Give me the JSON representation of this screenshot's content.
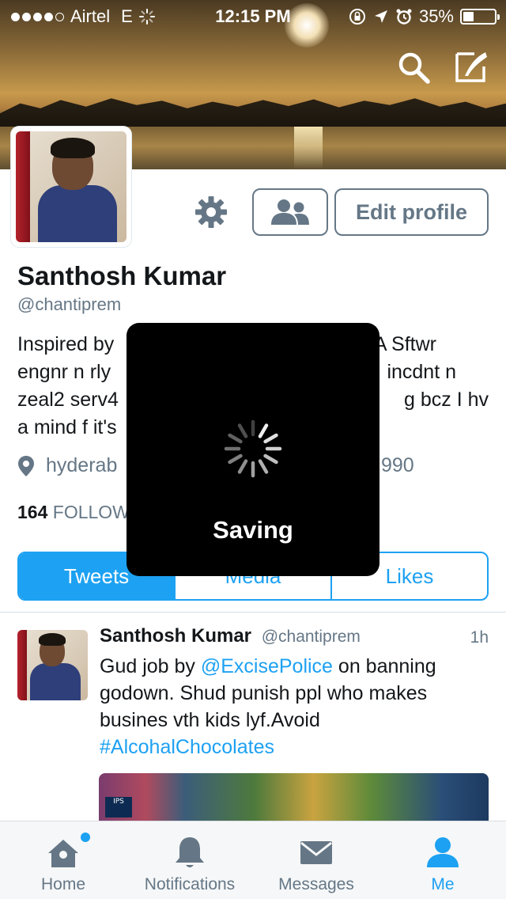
{
  "status_bar": {
    "carrier": "Airtel",
    "network": "E",
    "time": "12:15 PM",
    "battery": "35%",
    "battery_level": 0.35
  },
  "header": {
    "search_icon": "search-icon",
    "compose_icon": "compose-icon"
  },
  "profile": {
    "name": "Santhosh Kumar",
    "handle": "@chantiprem",
    "bio_lines": [
      "Inspired by",
      "A Sftwr",
      "engnr n rly",
      "incdnt n",
      "zeal2 serv4",
      "g bcz I hv",
      "a mind f it's"
    ],
    "location": "hyderab",
    "birth_fragment": "990",
    "following_count": "164",
    "following_label": "FOLLOW",
    "edit_profile_label": "Edit profile"
  },
  "tabs": [
    {
      "label": "Tweets",
      "active": true
    },
    {
      "label": "Media",
      "active": false
    },
    {
      "label": "Likes",
      "active": false
    }
  ],
  "tweet": {
    "author": "Santhosh Kumar",
    "handle": "@chantiprem",
    "time": "1h",
    "text_before": "Gud job by ",
    "mention": "@ExcisePolice",
    "text_after": " on banning godown. Shud punish ppl who makes busines vth kids lyf.Avoid ",
    "hashtag": "#AlcohalChocolates",
    "media_tag": "IPS"
  },
  "tab_bar": [
    {
      "label": "Home",
      "icon": "home-icon",
      "active": false,
      "has_dot": true
    },
    {
      "label": "Notifications",
      "icon": "bell-icon",
      "active": false
    },
    {
      "label": "Messages",
      "icon": "envelope-icon",
      "active": false
    },
    {
      "label": "Me",
      "icon": "person-icon",
      "active": true
    }
  ],
  "overlay": {
    "message": "Saving"
  },
  "colors": {
    "accent": "#1da1f2",
    "muted": "#657786",
    "text": "#14171a",
    "overlay_bg": "#000000"
  }
}
